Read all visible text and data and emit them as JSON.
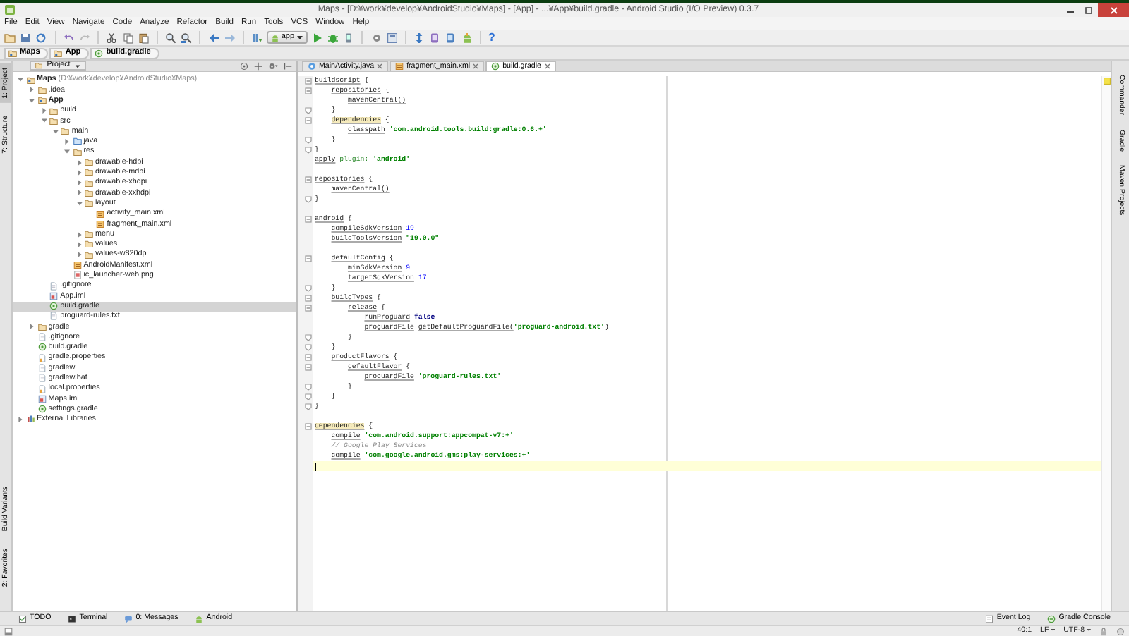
{
  "window": {
    "title": "Maps - [D:¥work¥develop¥AndroidStudio¥Maps] - [App] - ...¥App¥build.gradle - Android Studio (I/O Preview) 0.3.7"
  },
  "menu": [
    "File",
    "Edit",
    "View",
    "Navigate",
    "Code",
    "Analyze",
    "Refactor",
    "Build",
    "Run",
    "Tools",
    "VCS",
    "Window",
    "Help"
  ],
  "toolbar": {
    "run_config": "app",
    "help": "?"
  },
  "breadcrumbs": [
    {
      "label": "Maps",
      "kind": "module"
    },
    {
      "label": "App",
      "kind": "module"
    },
    {
      "label": "build.gradle",
      "kind": "gradle"
    }
  ],
  "left_tool_strip": {
    "top": [
      {
        "label": "1: Project",
        "selected": true
      },
      {
        "label": "7: Structure",
        "selected": false
      }
    ],
    "bottom": [
      {
        "label": "Build Variants",
        "selected": false
      },
      {
        "label": "2: Favorites",
        "selected": false
      }
    ]
  },
  "right_tool_strip": [
    "Commander",
    "Gradle",
    "Maven Projects"
  ],
  "project_panel": {
    "view": "Project",
    "tree": [
      {
        "label": "Maps",
        "kind": "module",
        "note": "(D:¥work¥develop¥AndroidStudio¥Maps)",
        "expanded": true,
        "selected": false,
        "children": [
          {
            "label": ".idea",
            "kind": "folder",
            "expanded": false,
            "selected": false
          },
          {
            "label": "App",
            "kind": "module",
            "expanded": true,
            "selected": false,
            "children": [
              {
                "label": "build",
                "kind": "folder",
                "expanded": false,
                "selected": false
              },
              {
                "label": "src",
                "kind": "folder",
                "expanded": true,
                "selected": false,
                "children": [
                  {
                    "label": "main",
                    "kind": "folder",
                    "expanded": true,
                    "selected": false,
                    "children": [
                      {
                        "label": "java",
                        "kind": "source_folder",
                        "expanded": false,
                        "selected": false
                      },
                      {
                        "label": "res",
                        "kind": "folder",
                        "expanded": true,
                        "selected": false,
                        "children": [
                          {
                            "label": "drawable-hdpi",
                            "kind": "folder",
                            "expanded": false,
                            "selected": false
                          },
                          {
                            "label": "drawable-mdpi",
                            "kind": "folder",
                            "expanded": false,
                            "selected": false
                          },
                          {
                            "label": "drawable-xhdpi",
                            "kind": "folder",
                            "expanded": false,
                            "selected": false
                          },
                          {
                            "label": "drawable-xxhdpi",
                            "kind": "folder",
                            "expanded": false,
                            "selected": false
                          },
                          {
                            "label": "layout",
                            "kind": "folder",
                            "expanded": true,
                            "selected": false,
                            "children": [
                              {
                                "label": "activity_main.xml",
                                "kind": "xml",
                                "selected": false
                              },
                              {
                                "label": "fragment_main.xml",
                                "kind": "xml",
                                "selected": false
                              }
                            ]
                          },
                          {
                            "label": "menu",
                            "kind": "folder",
                            "expanded": false,
                            "selected": false
                          },
                          {
                            "label": "values",
                            "kind": "folder",
                            "expanded": false,
                            "selected": false
                          },
                          {
                            "label": "values-w820dp",
                            "kind": "folder",
                            "expanded": false,
                            "selected": false
                          }
                        ]
                      },
                      {
                        "label": "AndroidManifest.xml",
                        "kind": "xml",
                        "selected": false
                      },
                      {
                        "label": "ic_launcher-web.png",
                        "kind": "image",
                        "selected": false
                      }
                    ]
                  }
                ]
              },
              {
                "label": ".gitignore",
                "kind": "file",
                "selected": false
              },
              {
                "label": "App.iml",
                "kind": "iml",
                "selected": false
              },
              {
                "label": "build.gradle",
                "kind": "gradle",
                "selected": true
              },
              {
                "label": "proguard-rules.txt",
                "kind": "file",
                "selected": false
              }
            ]
          },
          {
            "label": "gradle",
            "kind": "folder",
            "expanded": false,
            "selected": false
          },
          {
            "label": ".gitignore",
            "kind": "file",
            "selected": false
          },
          {
            "label": "build.gradle",
            "kind": "gradle",
            "selected": false
          },
          {
            "label": "gradle.properties",
            "kind": "properties",
            "selected": false
          },
          {
            "label": "gradlew",
            "kind": "file",
            "selected": false
          },
          {
            "label": "gradlew.bat",
            "kind": "file",
            "selected": false
          },
          {
            "label": "local.properties",
            "kind": "properties",
            "selected": false
          },
          {
            "label": "Maps.iml",
            "kind": "iml",
            "selected": false
          },
          {
            "label": "settings.gradle",
            "kind": "gradle",
            "selected": false
          }
        ]
      },
      {
        "label": "External Libraries",
        "kind": "library",
        "expanded": false,
        "selected": false
      }
    ]
  },
  "editor": {
    "tabs": [
      {
        "label": "MainActivity.java",
        "kind": "java",
        "selected": false
      },
      {
        "label": "fragment_main.xml",
        "kind": "xml",
        "selected": false
      },
      {
        "label": "build.gradle",
        "kind": "gradle",
        "selected": true
      }
    ],
    "lines": [
      {
        "kind": "block_start",
        "tokens": [
          {
            "text": "buildscript",
            "kind": "call"
          },
          {
            "text": " {",
            "kind": "plain"
          }
        ]
      },
      {
        "kind": "block_start",
        "tokens": [
          {
            "text": "    repositories",
            "kind": "call"
          },
          {
            "text": " {",
            "kind": "plain"
          }
        ]
      },
      {
        "kind": "code",
        "tokens": [
          {
            "text": "        mavenCentral()",
            "kind": "call"
          }
        ]
      },
      {
        "kind": "block_end",
        "tokens": [
          {
            "text": "    }",
            "kind": "plain"
          }
        ]
      },
      {
        "kind": "block_start",
        "tokens": [
          {
            "text": "    dependencies",
            "kind": "highlight"
          },
          {
            "text": " {",
            "kind": "plain"
          }
        ]
      },
      {
        "kind": "code",
        "tokens": [
          {
            "text": "        classpath ",
            "kind": "call"
          },
          {
            "text": "'com.android.tools.build:gradle:0.6.+'",
            "kind": "string"
          }
        ]
      },
      {
        "kind": "block_end",
        "tokens": [
          {
            "text": "    }",
            "kind": "plain"
          }
        ]
      },
      {
        "kind": "block_end",
        "tokens": [
          {
            "text": "}",
            "kind": "plain"
          }
        ]
      },
      {
        "kind": "code",
        "tokens": [
          {
            "text": "apply ",
            "kind": "call"
          },
          {
            "text": "plugin: ",
            "kind": "label"
          },
          {
            "text": "'android'",
            "kind": "string"
          }
        ]
      },
      {
        "kind": "blank"
      },
      {
        "kind": "block_start",
        "tokens": [
          {
            "text": "repositories",
            "kind": "call"
          },
          {
            "text": " {",
            "kind": "plain"
          }
        ]
      },
      {
        "kind": "code",
        "tokens": [
          {
            "text": "    mavenCentral()",
            "kind": "call"
          }
        ]
      },
      {
        "kind": "block_end",
        "tokens": [
          {
            "text": "}",
            "kind": "plain"
          }
        ]
      },
      {
        "kind": "blank"
      },
      {
        "kind": "block_start",
        "tokens": [
          {
            "text": "android",
            "kind": "call"
          },
          {
            "text": " {",
            "kind": "plain"
          }
        ]
      },
      {
        "kind": "code",
        "tokens": [
          {
            "text": "    compileSdkVersion ",
            "kind": "call"
          },
          {
            "text": "19",
            "kind": "number"
          }
        ]
      },
      {
        "kind": "code",
        "tokens": [
          {
            "text": "    buildToolsVersion ",
            "kind": "call"
          },
          {
            "text": "\"19.0.0\"",
            "kind": "string"
          }
        ]
      },
      {
        "kind": "blank"
      },
      {
        "kind": "block_start",
        "tokens": [
          {
            "text": "    defaultConfig",
            "kind": "call"
          },
          {
            "text": " {",
            "kind": "plain"
          }
        ]
      },
      {
        "kind": "code",
        "tokens": [
          {
            "text": "        minSdkVersion ",
            "kind": "call"
          },
          {
            "text": "9",
            "kind": "number"
          }
        ]
      },
      {
        "kind": "code",
        "tokens": [
          {
            "text": "        targetSdkVersion ",
            "kind": "call"
          },
          {
            "text": "17",
            "kind": "number"
          }
        ]
      },
      {
        "kind": "block_end",
        "tokens": [
          {
            "text": "    }",
            "kind": "plain"
          }
        ]
      },
      {
        "kind": "block_start",
        "tokens": [
          {
            "text": "    buildTypes",
            "kind": "call"
          },
          {
            "text": " {",
            "kind": "plain"
          }
        ]
      },
      {
        "kind": "block_start",
        "tokens": [
          {
            "text": "        release",
            "kind": "call"
          },
          {
            "text": " {",
            "kind": "plain"
          }
        ]
      },
      {
        "kind": "code",
        "tokens": [
          {
            "text": "            runProguard ",
            "kind": "call"
          },
          {
            "text": "false",
            "kind": "keyword"
          }
        ]
      },
      {
        "kind": "code",
        "tokens": [
          {
            "text": "            proguardFile ",
            "kind": "call"
          },
          {
            "text": "getDefaultProguardFile(",
            "kind": "call"
          },
          {
            "text": "'proguard-android.txt'",
            "kind": "string"
          },
          {
            "text": ")",
            "kind": "plain"
          }
        ]
      },
      {
        "kind": "block_end",
        "tokens": [
          {
            "text": "        }",
            "kind": "plain"
          }
        ]
      },
      {
        "kind": "block_end",
        "tokens": [
          {
            "text": "    }",
            "kind": "plain"
          }
        ]
      },
      {
        "kind": "block_start",
        "tokens": [
          {
            "text": "    productFlavors",
            "kind": "call"
          },
          {
            "text": " {",
            "kind": "plain"
          }
        ]
      },
      {
        "kind": "block_start",
        "tokens": [
          {
            "text": "        defaultFlavor",
            "kind": "call"
          },
          {
            "text": " {",
            "kind": "plain"
          }
        ]
      },
      {
        "kind": "code",
        "tokens": [
          {
            "text": "            proguardFile ",
            "kind": "call"
          },
          {
            "text": "'proguard-rules.txt'",
            "kind": "string"
          }
        ]
      },
      {
        "kind": "block_end",
        "tokens": [
          {
            "text": "        }",
            "kind": "plain"
          }
        ]
      },
      {
        "kind": "block_end",
        "tokens": [
          {
            "text": "    }",
            "kind": "plain"
          }
        ]
      },
      {
        "kind": "block_end",
        "tokens": [
          {
            "text": "}",
            "kind": "plain"
          }
        ]
      },
      {
        "kind": "blank"
      },
      {
        "kind": "block_start",
        "tokens": [
          {
            "text": "dependencies",
            "kind": "highlight"
          },
          {
            "text": " {",
            "kind": "plain"
          }
        ]
      },
      {
        "kind": "code",
        "tokens": [
          {
            "text": "    compile ",
            "kind": "call"
          },
          {
            "text": "'com.android.support:appcompat-v7:+'",
            "kind": "string"
          }
        ]
      },
      {
        "kind": "code",
        "tokens": [
          {
            "text": "    // Google Play Services",
            "kind": "comment"
          }
        ]
      },
      {
        "kind": "code",
        "tokens": [
          {
            "text": "    compile ",
            "kind": "call"
          },
          {
            "text": "'com.google.android.gms:play-services:+'",
            "kind": "string"
          }
        ]
      },
      {
        "kind": "blank",
        "current": true
      }
    ]
  },
  "bottom_toolbar": {
    "left": [
      {
        "label": "TODO",
        "kind": "todo"
      },
      {
        "label": "Terminal",
        "kind": "terminal"
      },
      {
        "label": "0: Messages",
        "kind": "messages"
      },
      {
        "label": "Android",
        "kind": "android"
      }
    ],
    "right": [
      {
        "label": "Event Log",
        "kind": "log"
      },
      {
        "label": "Gradle Console",
        "kind": "console"
      }
    ]
  },
  "status_bar": {
    "position": "40:1",
    "line_separator": "LF ÷",
    "encoding": "UTF-8 ÷"
  }
}
